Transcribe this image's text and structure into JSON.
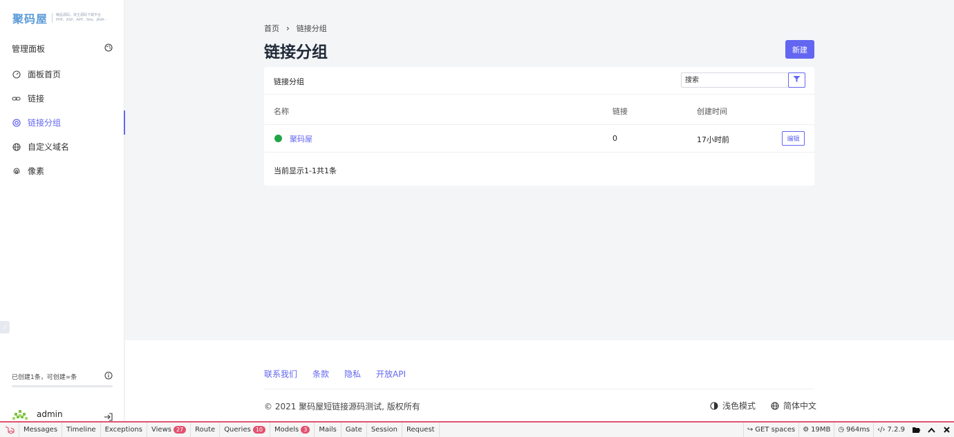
{
  "sidebar": {
    "logo_main": "聚码屋",
    "logo_sub_line1": "精品源码，资主源码下载平台",
    "logo_sub_line2": "PHP、ASP、APP、Site、JAVA···",
    "panel_title": "管理面板",
    "items": [
      {
        "label": "面板首页",
        "icon": "dashboard-icon"
      },
      {
        "label": "链接",
        "icon": "link-icon"
      },
      {
        "label": "链接分组",
        "icon": "target-icon",
        "active": true
      },
      {
        "label": "自定义域名",
        "icon": "globe-icon"
      },
      {
        "label": "像素",
        "icon": "fingerprint-icon"
      }
    ],
    "quota_text": "已创建1条，可创建∞条",
    "user_name": "admin"
  },
  "breadcrumb": {
    "home": "首页",
    "current": "链接分组"
  },
  "page": {
    "title": "链接分组",
    "new_button": "新建"
  },
  "card": {
    "title": "链接分组",
    "search_placeholder": "搜索",
    "columns": {
      "name": "名称",
      "links": "链接",
      "created": "创建时间"
    },
    "rows": [
      {
        "name": "聚码屋",
        "links": "0",
        "created": "17小时前",
        "status_color": "#22a447",
        "action": "编辑"
      }
    ],
    "pager_text": "当前显示1-1共1条"
  },
  "footer": {
    "links": [
      "联系我们",
      "条款",
      "隐私",
      "开放API"
    ],
    "copyright": "© 2021 聚码屋短链接源码测试, 版权所有",
    "theme": "浅色模式",
    "language": "简体中文"
  },
  "debugbar": {
    "tabs": [
      {
        "label": "Messages"
      },
      {
        "label": "Timeline"
      },
      {
        "label": "Exceptions"
      },
      {
        "label": "Views",
        "badge": "27"
      },
      {
        "label": "Route"
      },
      {
        "label": "Queries",
        "badge": "10"
      },
      {
        "label": "Models",
        "badge": "3"
      },
      {
        "label": "Mails"
      },
      {
        "label": "Gate"
      },
      {
        "label": "Session"
      },
      {
        "label": "Request"
      }
    ],
    "request": "GET spaces",
    "memory": "19MB",
    "time": "964ms",
    "php_version": "7.2.9"
  },
  "colors": {
    "accent": "#6366f1",
    "status_green": "#22a447",
    "debug_red": "#e2526f"
  }
}
